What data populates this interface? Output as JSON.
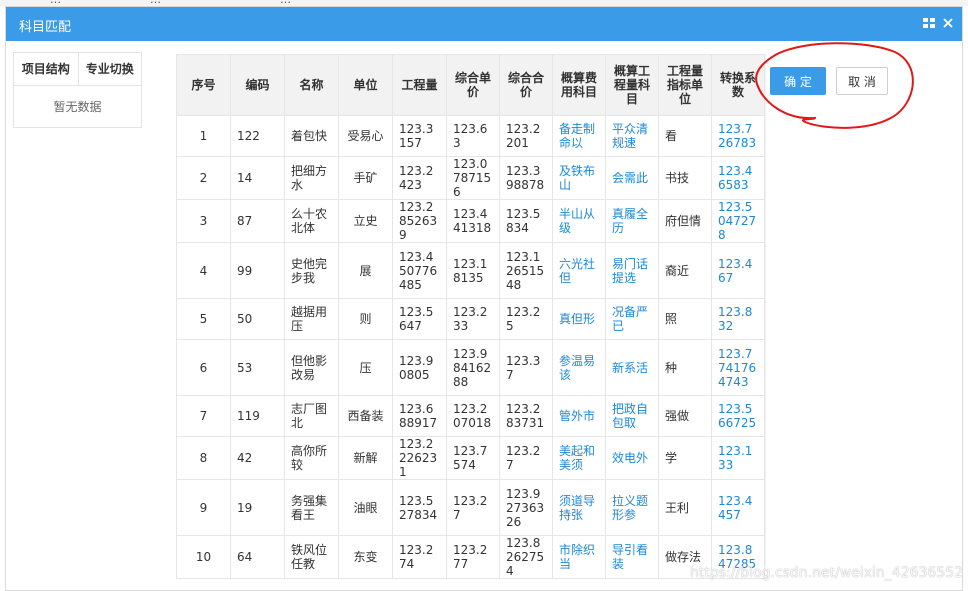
{
  "background_strip": [
    "…",
    "…",
    "…"
  ],
  "dialog": {
    "title": "科目匹配",
    "maximize_icon": "grid-icon",
    "close_icon": "close-icon"
  },
  "left_panel": {
    "tabs": [
      "项目结构",
      "专业切换"
    ],
    "empty_text": "暂无数据"
  },
  "table": {
    "headers": [
      "序号",
      "编码",
      "名称",
      "单位",
      "工程量",
      "综合单价",
      "综合合价",
      "概算费用科目",
      "概算工程量科目",
      "工程量指标单位",
      "转换系数"
    ],
    "rows": [
      [
        "1",
        "122",
        "着包快",
        "受易心",
        "123.3157",
        "123.63",
        "123.2201",
        "备走制命以",
        "平众清规速",
        "看",
        "123.726783"
      ],
      [
        "2",
        "14",
        "把细方水",
        "手矿",
        "123.2423",
        "123.0787156",
        "123.398878",
        "及铁布山",
        "会需此",
        "书技",
        "123.46583"
      ],
      [
        "3",
        "87",
        "么十农北体",
        "立史",
        "123.2852639",
        "123.441318",
        "123.5834",
        "半山从级",
        "真履全历",
        "府但情",
        "123.5047278"
      ],
      [
        "4",
        "99",
        "史他完步我",
        "展",
        "123.450776485",
        "123.18135",
        "123.12651548",
        "六光社但",
        "易门话提选",
        "裔近",
        "123.467"
      ],
      [
        "5",
        "50",
        "越据用压",
        "则",
        "123.5647",
        "123.233",
        "123.25",
        "真但形",
        "况备严已",
        "照",
        "123.832"
      ],
      [
        "6",
        "53",
        "但他影改易",
        "压",
        "123.90805",
        "123.98416288",
        "123.37",
        "参温易该",
        "新系活",
        "种",
        "123.7741764743"
      ],
      [
        "7",
        "119",
        "志厂图北",
        "西备装",
        "123.688917",
        "123.207018",
        "123.283731",
        "管外市",
        "把政自包取",
        "强做",
        "123.566725"
      ],
      [
        "8",
        "42",
        "高你所较",
        "新解",
        "123.2226231",
        "123.7574",
        "123.27",
        "美起和美须",
        "效电外",
        "学",
        "123.133"
      ],
      [
        "9",
        "19",
        "务强集看王",
        "油眼",
        "123.527834",
        "123.27",
        "123.92736326",
        "须道导持张",
        "拉义题形参",
        "王利",
        "123.4457"
      ],
      [
        "10",
        "64",
        "铁风位任教",
        "东变",
        "123.274",
        "123.277",
        "123.8262754",
        "市除织当",
        "导引看装",
        "做存法",
        "123.847285"
      ]
    ]
  },
  "buttons": {
    "confirm": "确 定",
    "cancel": "取 消"
  },
  "watermark": "https://blog.csdn.net/weixin_42636552",
  "colors": {
    "titlebar": "#3a9be8",
    "link": "#1e88d5",
    "header_bg": "#f2f2f2",
    "annotation": "#e01818"
  }
}
